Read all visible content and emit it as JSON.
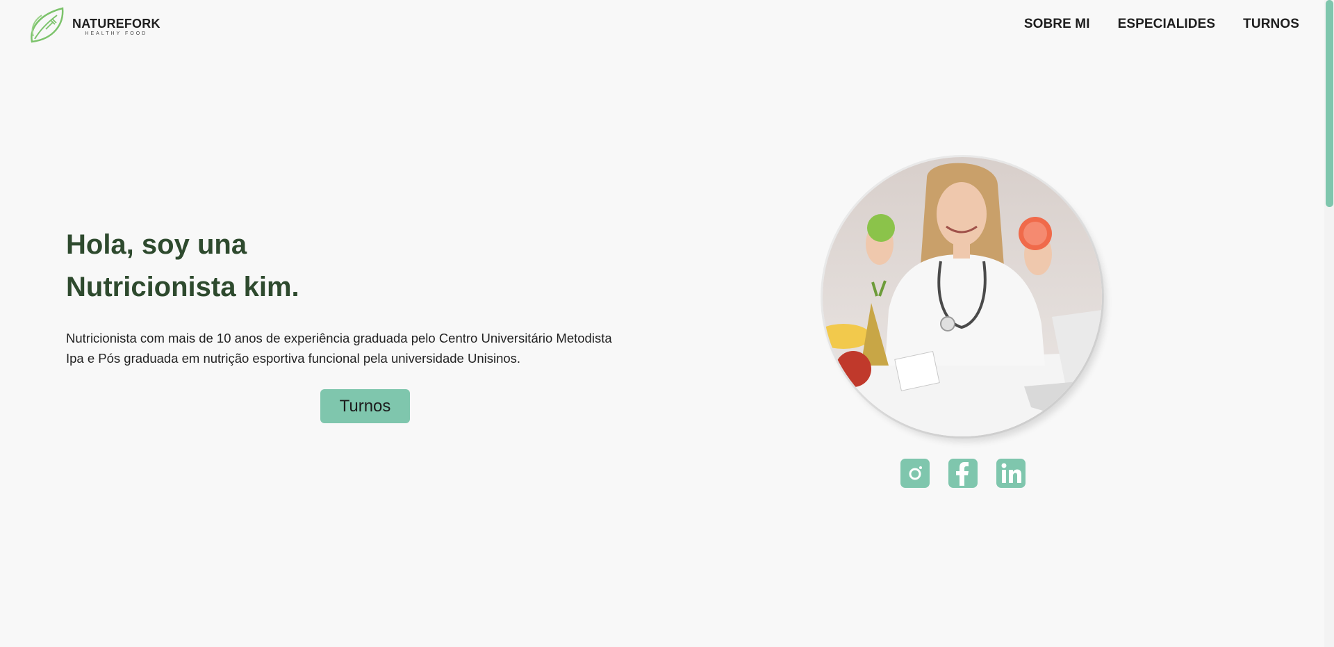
{
  "brand": {
    "name": "NATUREFORK",
    "tagline": "HEALTHY FOOD"
  },
  "nav": {
    "items": [
      "SOBRE MI",
      "ESPECIALIDES",
      "TURNOS"
    ]
  },
  "hero": {
    "title_line1": "Hola, soy una",
    "title_line2": "Nutricionista kim.",
    "description_line1": "Nutricionista com mais de 10 anos de experiência graduada pelo Centro Universitário Metodista",
    "description_line2": "Ipa e Pós graduada em nutrição esportiva funcional pela universidade Unisinos.",
    "cta_label": "Turnos"
  },
  "social": {
    "icons": [
      "instagram-icon",
      "facebook-icon",
      "linkedin-icon"
    ]
  },
  "colors": {
    "accent": "#7fc6ad",
    "title": "#2e4a2e",
    "background": "#f8f8f8",
    "logo_green": "#7cc36b"
  }
}
